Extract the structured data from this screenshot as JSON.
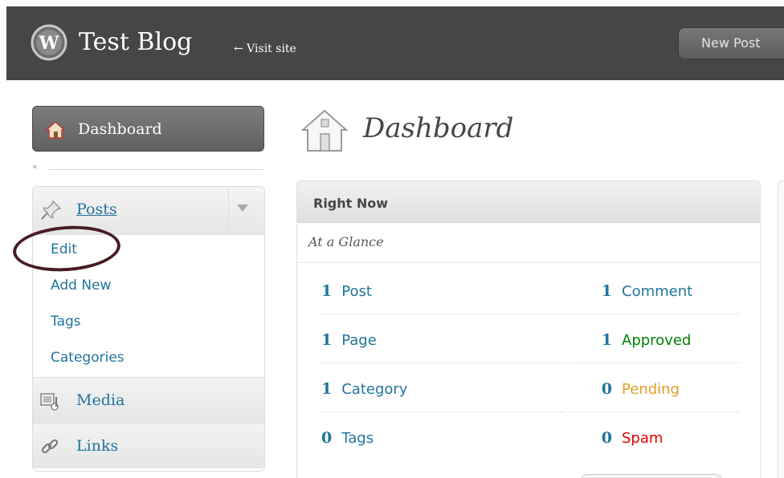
{
  "header": {
    "site_title": "Test Blog",
    "visit_site": "← Visit site",
    "new_post_button": "New Post"
  },
  "sidebar": {
    "dashboard_label": "Dashboard",
    "collapse_glyph": "«",
    "posts_label": "Posts",
    "posts_submenu": [
      "Edit",
      "Add New",
      "Tags",
      "Categories"
    ],
    "media_label": "Media",
    "links_label": "Links"
  },
  "main": {
    "page_title": "Dashboard",
    "right_now": {
      "title": "Right Now",
      "subtitle": "At a Glance",
      "content": [
        {
          "num": "1",
          "label": "Post"
        },
        {
          "num": "1",
          "label": "Page"
        },
        {
          "num": "1",
          "label": "Category"
        },
        {
          "num": "0",
          "label": "Tags"
        }
      ],
      "discussion": [
        {
          "num": "1",
          "label": "Comment",
          "color": "#21759b"
        },
        {
          "num": "1",
          "label": "Approved",
          "color": "#008000"
        },
        {
          "num": "0",
          "label": "Pending",
          "color": "#e39d25"
        },
        {
          "num": "0",
          "label": "Spam",
          "color": "#e00000"
        }
      ]
    }
  },
  "colors": {
    "header_bg": "#464646",
    "link": "#21759b",
    "highlight_circle": "#4a1b22"
  }
}
